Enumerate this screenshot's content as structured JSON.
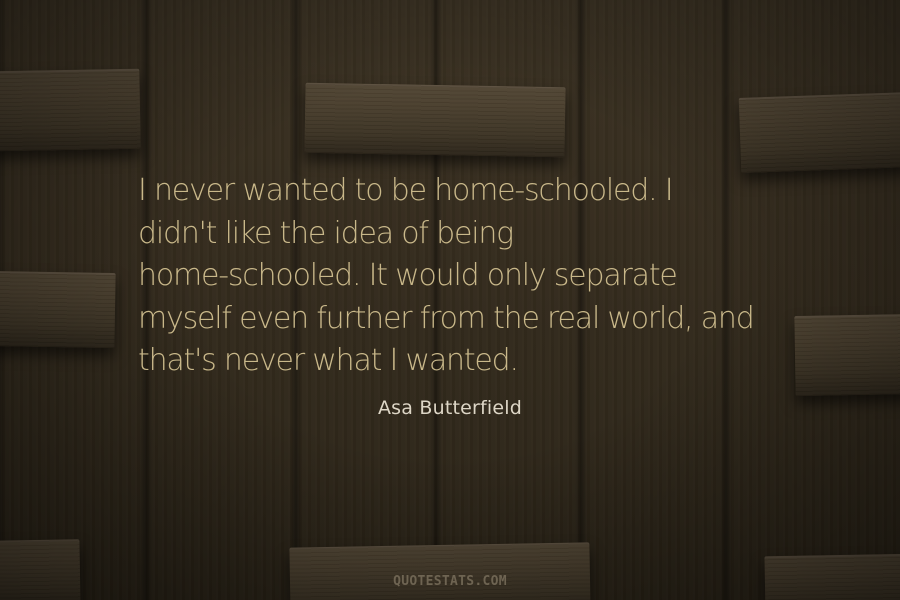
{
  "quote": {
    "lines": [
      "I never wanted to be home-schooled. I",
      "didn't like the idea of being",
      "home-schooled. It would only separate",
      "myself even further from the real world, and",
      "that's never what I wanted."
    ]
  },
  "author": "Asa Butterfield",
  "source": "QUOTESTATS.COM",
  "colors": {
    "quote_text": "#c9b88a",
    "author_text": "#ddd6c6",
    "background": "#352c1e"
  }
}
